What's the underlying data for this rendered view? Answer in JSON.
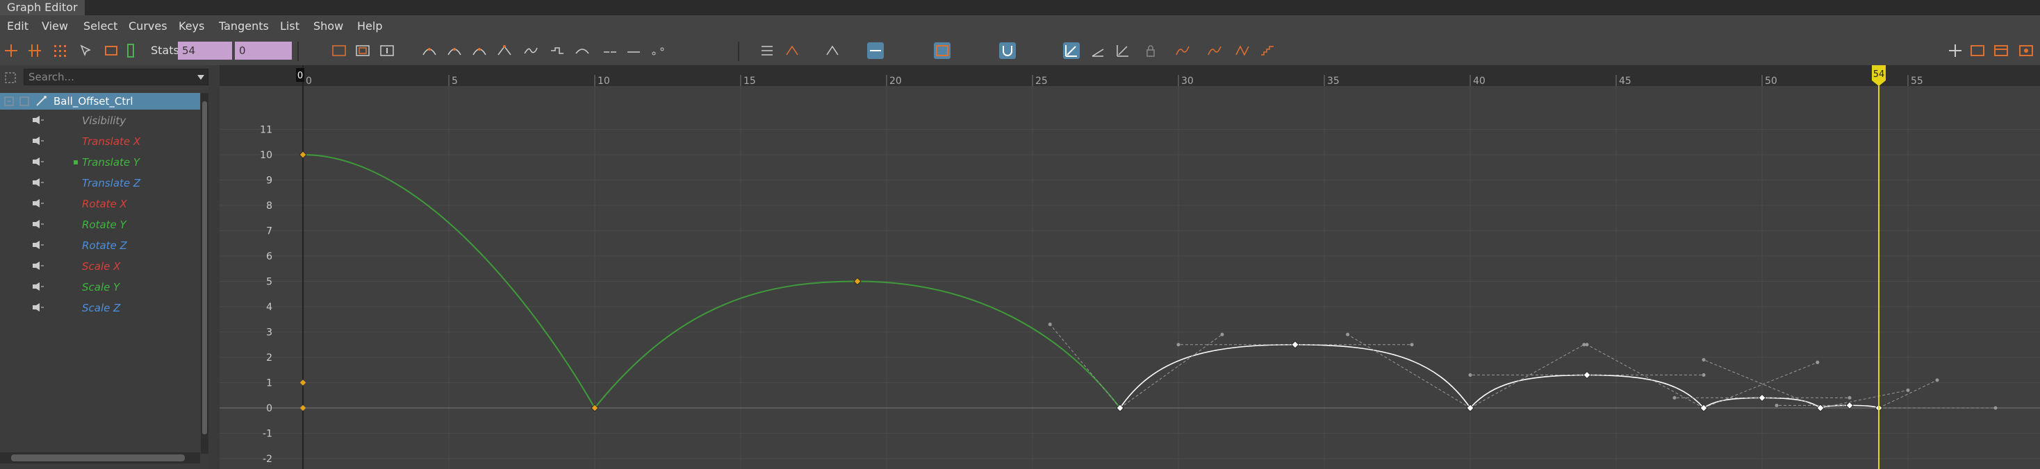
{
  "window": {
    "title": "Graph Editor"
  },
  "menu": [
    "Edit",
    "View",
    "Select",
    "Curves",
    "Keys",
    "Tangents",
    "List",
    "Show",
    "Help"
  ],
  "toolbar": {
    "stats_label": "Stats",
    "stats_value_1": "54",
    "stats_value_2": "0"
  },
  "outliner": {
    "search_placeholder": "Search...",
    "object": "Ball_Offset_Ctrl",
    "channels": [
      {
        "label": "Visibility",
        "color": "#9a9a9a"
      },
      {
        "label": "Translate X",
        "color": "#d8403a"
      },
      {
        "label": "Translate Y",
        "color": "#41b53f"
      },
      {
        "label": "Translate Z",
        "color": "#4d8fdc"
      },
      {
        "label": "Rotate X",
        "color": "#d8403a"
      },
      {
        "label": "Rotate Y",
        "color": "#41b53f"
      },
      {
        "label": "Rotate Z",
        "color": "#4d8fdc"
      },
      {
        "label": "Scale X",
        "color": "#d8403a"
      },
      {
        "label": "Scale Y",
        "color": "#41b53f"
      },
      {
        "label": "Scale Z",
        "color": "#4d8fdc"
      }
    ]
  },
  "graph": {
    "frame_ticks": [
      "0",
      "5",
      "10",
      "15",
      "20",
      "25",
      "30",
      "35",
      "40",
      "45",
      "50",
      "55"
    ],
    "value_ticks": [
      "11",
      "10",
      "9",
      "8",
      "7",
      "6",
      "5",
      "4",
      "3",
      "2",
      "1",
      "0",
      "-1",
      "-2"
    ],
    "current_frame": "54",
    "start_marker": "0",
    "colors": {
      "curve_selected": "#ffffff",
      "curve_green": "#3f9a3a",
      "current_time": "#e5d31a",
      "accent": "#5285a6"
    },
    "curve_keys_frame_value": [
      [
        0,
        10
      ],
      [
        10,
        0
      ],
      [
        19,
        5
      ],
      [
        28,
        0
      ],
      [
        34,
        2.5
      ],
      [
        40,
        0
      ],
      [
        44,
        1.3
      ],
      [
        48,
        0
      ],
      [
        50,
        0.4
      ],
      [
        52,
        0
      ],
      [
        53,
        0.1
      ],
      [
        54,
        0
      ]
    ]
  }
}
